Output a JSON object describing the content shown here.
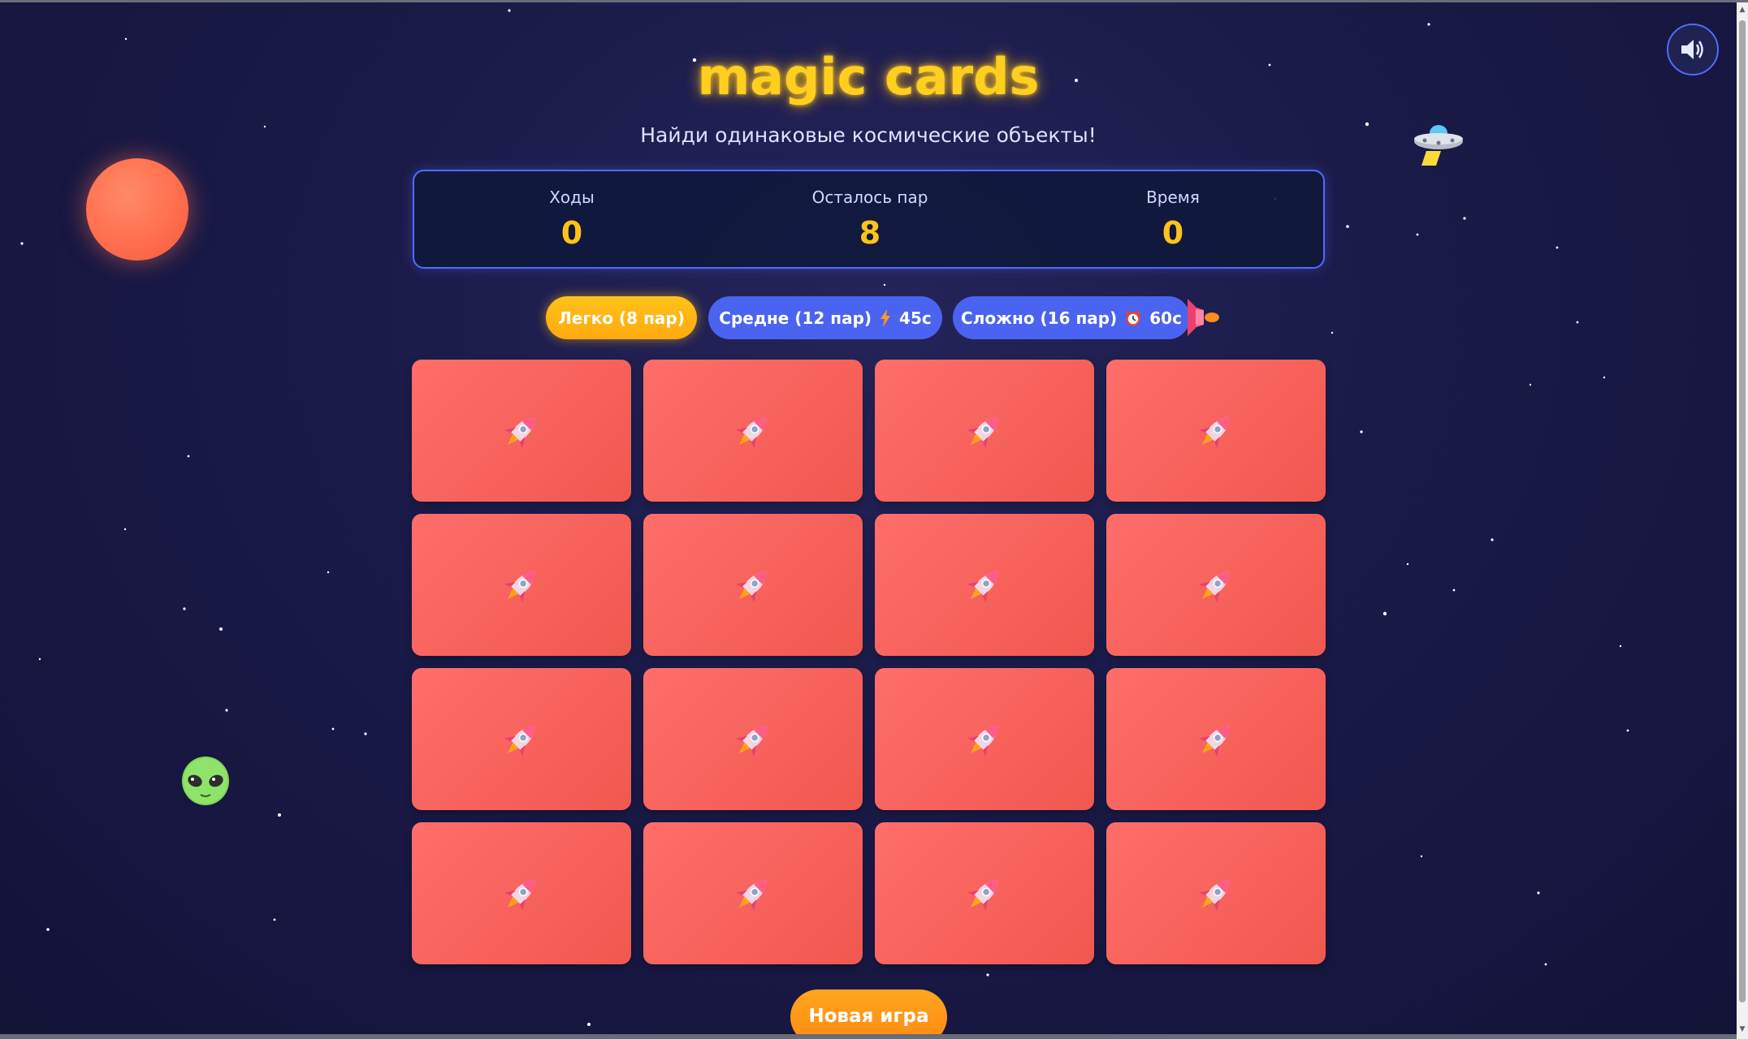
{
  "game": {
    "title": "magic cards",
    "subtitle": "Найди одинаковые космические объекты!"
  },
  "stats": [
    {
      "label": "Ходы",
      "value": "0"
    },
    {
      "label": "Осталось пар",
      "value": "8"
    },
    {
      "label": "Время",
      "value": "0"
    }
  ],
  "difficulty": {
    "easy": {
      "label": "Легко (8 пар)"
    },
    "medium": {
      "label": "Средне (12 пар)",
      "icon": "lightning-icon",
      "time": "45с"
    },
    "hard": {
      "label": "Сложно (16 пар)",
      "icon": "alarm-clock-icon",
      "time": "60с"
    }
  },
  "board": {
    "rows": 4,
    "cols": 4,
    "card_back_icon": "rocket-icon",
    "card_color": "#f6605a"
  },
  "actions": {
    "new_game": "Новая игра",
    "sound_icon": "speaker-icon"
  },
  "decor": [
    "planet",
    "alien-icon",
    "ufo-icon",
    "rocket-icon"
  ],
  "colors": {
    "accent": "#ffc21a",
    "button_blue": "#4a63f0",
    "background": "#1a1a48"
  }
}
